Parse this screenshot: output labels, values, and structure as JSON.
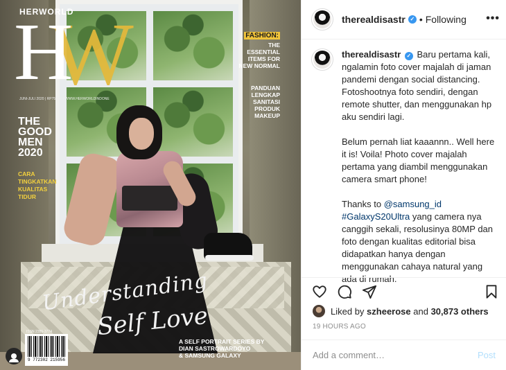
{
  "cover": {
    "brand_small": "HERWORLD",
    "brand_letter_h": "H",
    "brand_letter_w": "W",
    "issue_line": "JUNI-JULI 2020 | RP75.000 | WWW.HERWORLDINDONESIA.COM",
    "good_men": [
      "THE",
      "GOOD",
      "MEN",
      "2020"
    ],
    "tidur": [
      "CARA",
      "TINGKATKAN",
      "KUALITAS",
      "TIDUR"
    ],
    "fashion_head": "FASHION:",
    "fashion_body": [
      "THE",
      "ESSENTIAL",
      "ITEMS FOR",
      "NEW NORMAL"
    ],
    "panduan": [
      "PANDUAN",
      "LENGKAP",
      "SANITASI",
      "PRODUK",
      "MAKEUP"
    ],
    "script_line1": "Understanding",
    "script_line2": "Self Love",
    "series_line1": "A SELF PORTRAIT SERIES BY",
    "series_line2": "DIAN SASTROWARDOYO",
    "series_line3": "& SAMSUNG GALAXY",
    "barcode_top": "ISSN 2355-3774",
    "barcode_number": "9 772302 215956"
  },
  "header": {
    "username": "therealdisastr",
    "separator": "•",
    "following_label": "Following",
    "more_label": "•••"
  },
  "caption": {
    "username": "therealdisastr",
    "para1": "Baru pertama kali, ngalamin foto cover majalah di jaman pandemi dengan social distancing. Fotoshootnya foto sendiri, dengan remote shutter, dan menggunakan hp aku sendiri lagi.",
    "para2": "Belum pernah liat kaaannn.. Well here it is! Voila! Photo cover majalah pertama yang diambil menggunakan camera smart phone!",
    "para3_prefix": "Thanks to ",
    "mention": "@samsung_id",
    "hashtag": "#GalaxyS20Ultra",
    "para3_suffix": " yang camera nya canggih sekali, resolusinya 80MP dan foto dengan kualitas editorial bisa didapatkan hanya dengan menggunakan cahaya natural yang ada di rumah."
  },
  "likes": {
    "prefix": "Liked by ",
    "user": "szheerose",
    "middle": " and ",
    "count": "30,873 others"
  },
  "timestamp": "19 HOURS AGO",
  "comment": {
    "placeholder": "Add a comment…",
    "post_label": "Post"
  },
  "icons": {
    "like": "heart-icon",
    "comment": "comment-icon",
    "share": "paper-plane-icon",
    "save": "bookmark-icon",
    "verified": "verified-badge-icon",
    "tag": "user-tag-icon"
  },
  "colors": {
    "verified": "#3897f0",
    "link": "#00376b",
    "post_disabled": "#b2dffc",
    "cover_gold": "#e5b93b",
    "cover_yellow": "#f2d03e"
  }
}
